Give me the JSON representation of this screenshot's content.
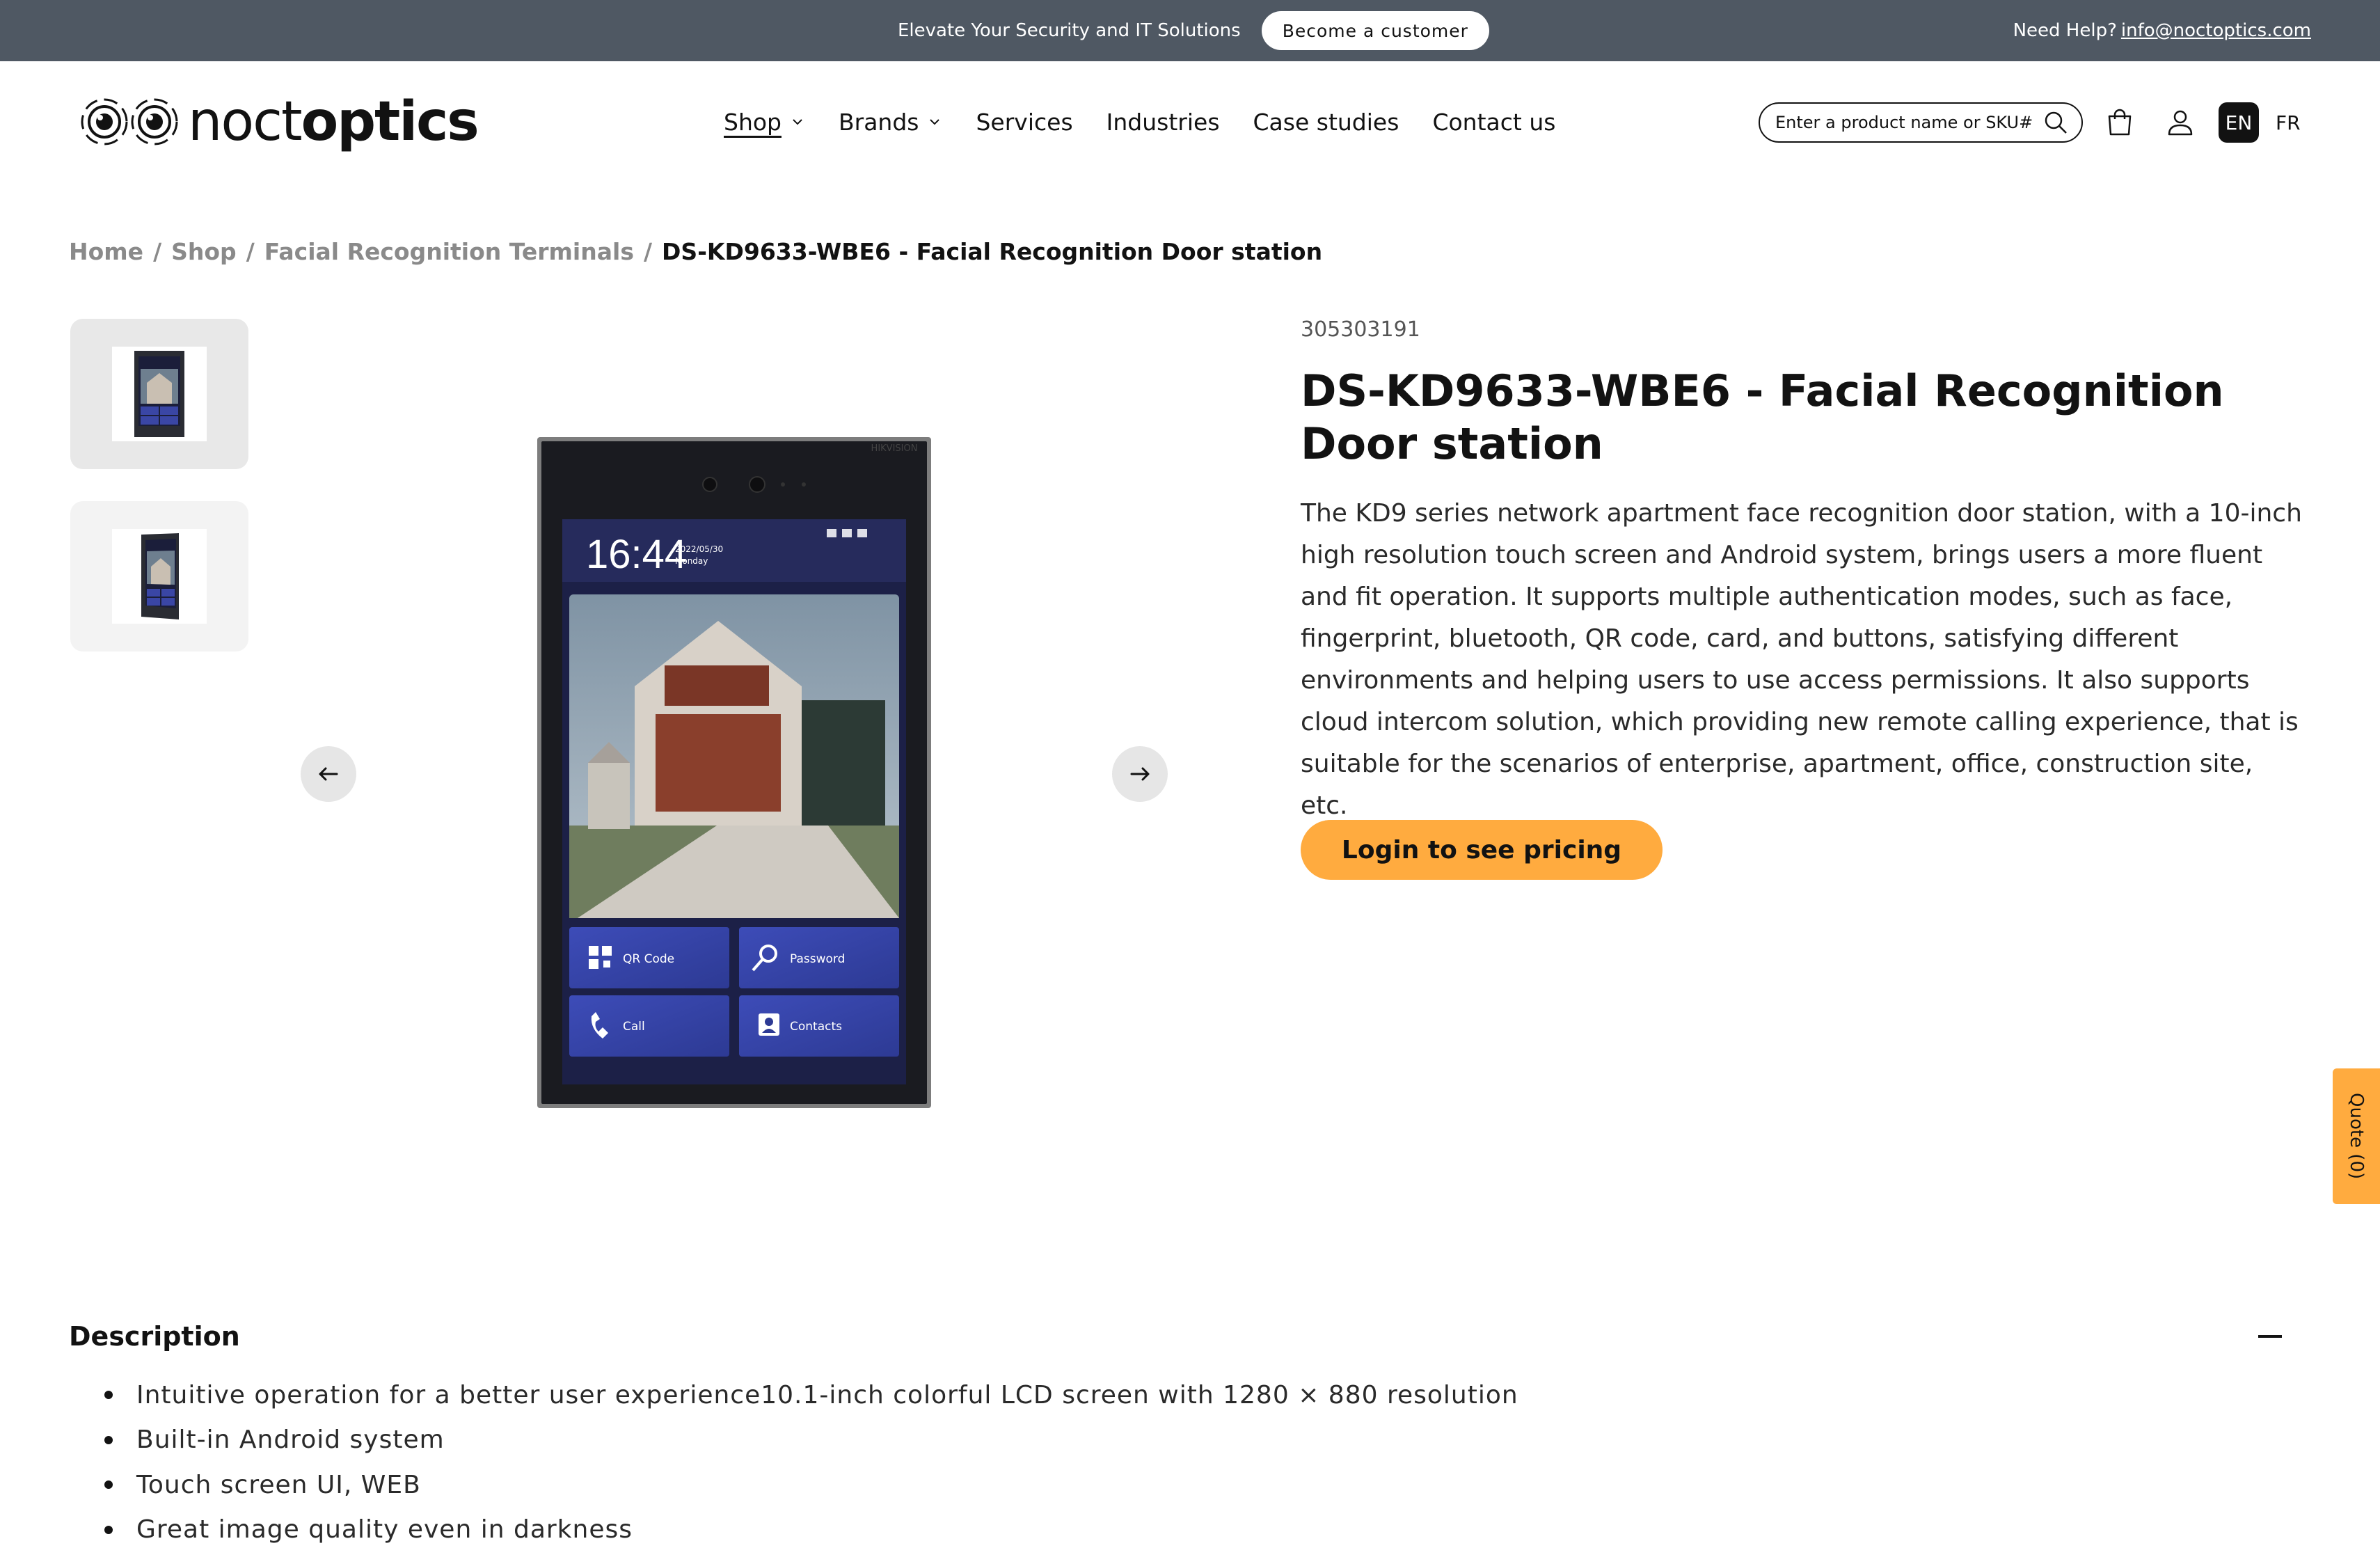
{
  "announcement": {
    "promo_text": "Elevate Your Security and IT Solutions",
    "cta_label": "Become a customer",
    "help_prefix": "Need Help?",
    "help_email": "info@noctoptics.com"
  },
  "header": {
    "logo_text_light": "noct",
    "logo_text_bold": "optics",
    "nav": [
      {
        "label": "Shop",
        "has_dropdown": true,
        "active": true
      },
      {
        "label": "Brands",
        "has_dropdown": true
      },
      {
        "label": "Services"
      },
      {
        "label": "Industries"
      },
      {
        "label": "Case studies"
      },
      {
        "label": "Contact us"
      }
    ],
    "search_placeholder": "Enter a product name or SKU#",
    "icons": [
      "search-icon",
      "cart-icon",
      "account-icon"
    ],
    "lang_active": "EN",
    "lang_other": "FR"
  },
  "breadcrumb": {
    "items": [
      "Home",
      "Shop",
      "Facial Recognition Terminals"
    ],
    "current": "DS-KD9633-WBE6 - Facial Recognition Door station",
    "separator": "/"
  },
  "product": {
    "sku": "305303191",
    "title": "DS-KD9633-WBE6 - Facial Recognition Door station",
    "description": "The KD9 series network apartment face recognition door station, with a 10-inch high resolution touch screen and Android system, brings users a more fluent and fit operation. It supports multiple authentication modes, such as face, fingerprint, bluetooth, QR code, card, and buttons, satisfying different environments and helping users to use access permissions. It also supports cloud intercom solution, which providing new remote calling experience, that is suitable for the scenarios of enterprise, apartment, office, construction site, etc.",
    "pricing_button": "Login to see pricing",
    "image": {
      "brand_mark": "HIKVISION",
      "time": "16:44",
      "date": "2022/05/30",
      "weekday": "Monday",
      "tiles": [
        "QR Code",
        "Password",
        "Call",
        "Contacts"
      ]
    }
  },
  "quote_tab": "Quote (0)",
  "description_section": {
    "heading": "Description",
    "bullets": [
      "Intuitive operation for a better user experience10.1-inch colorful LCD screen with 1280 × 880 resolution",
      "Built-in Android system",
      "Touch screen UI, WEB",
      "Great image quality even in darkness"
    ]
  },
  "colors": {
    "topbar": "#4f5863",
    "accent": "#ffab3f",
    "text": "#121212"
  }
}
